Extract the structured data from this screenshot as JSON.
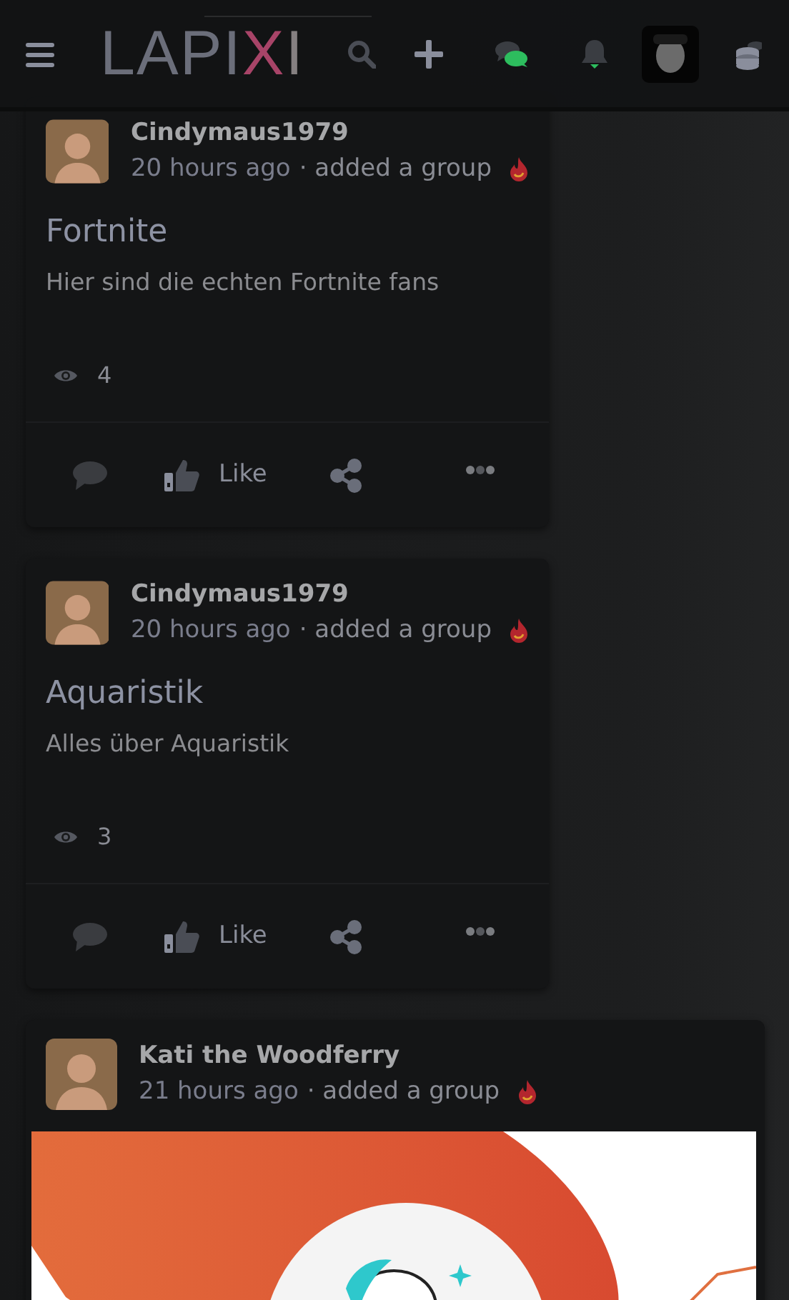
{
  "navbar": {
    "logo": [
      {
        "text": "LAPI",
        "highlighted": false
      },
      {
        "text": "X",
        "highlighted": true
      },
      {
        "text": "I",
        "highlighted": false
      }
    ]
  },
  "posts": [
    {
      "author": "Cindymaus1979",
      "time": "20 hours ago",
      "action": "· added a group",
      "title": "Fortnite",
      "description": "Hier sind die echten Fortnite fans",
      "views": "4",
      "like_label": "Like",
      "kind": "text"
    },
    {
      "author": "Cindymaus1979",
      "time": "20 hours ago",
      "action": "· added a group",
      "title": "Aquaristik",
      "description": "Alles über Aquaristik",
      "views": "3",
      "like_label": "Like",
      "kind": "text"
    },
    {
      "author": "Kati the Woodferry",
      "time": "21 hours ago",
      "action": "· added a group",
      "kind": "picture"
    }
  ]
}
